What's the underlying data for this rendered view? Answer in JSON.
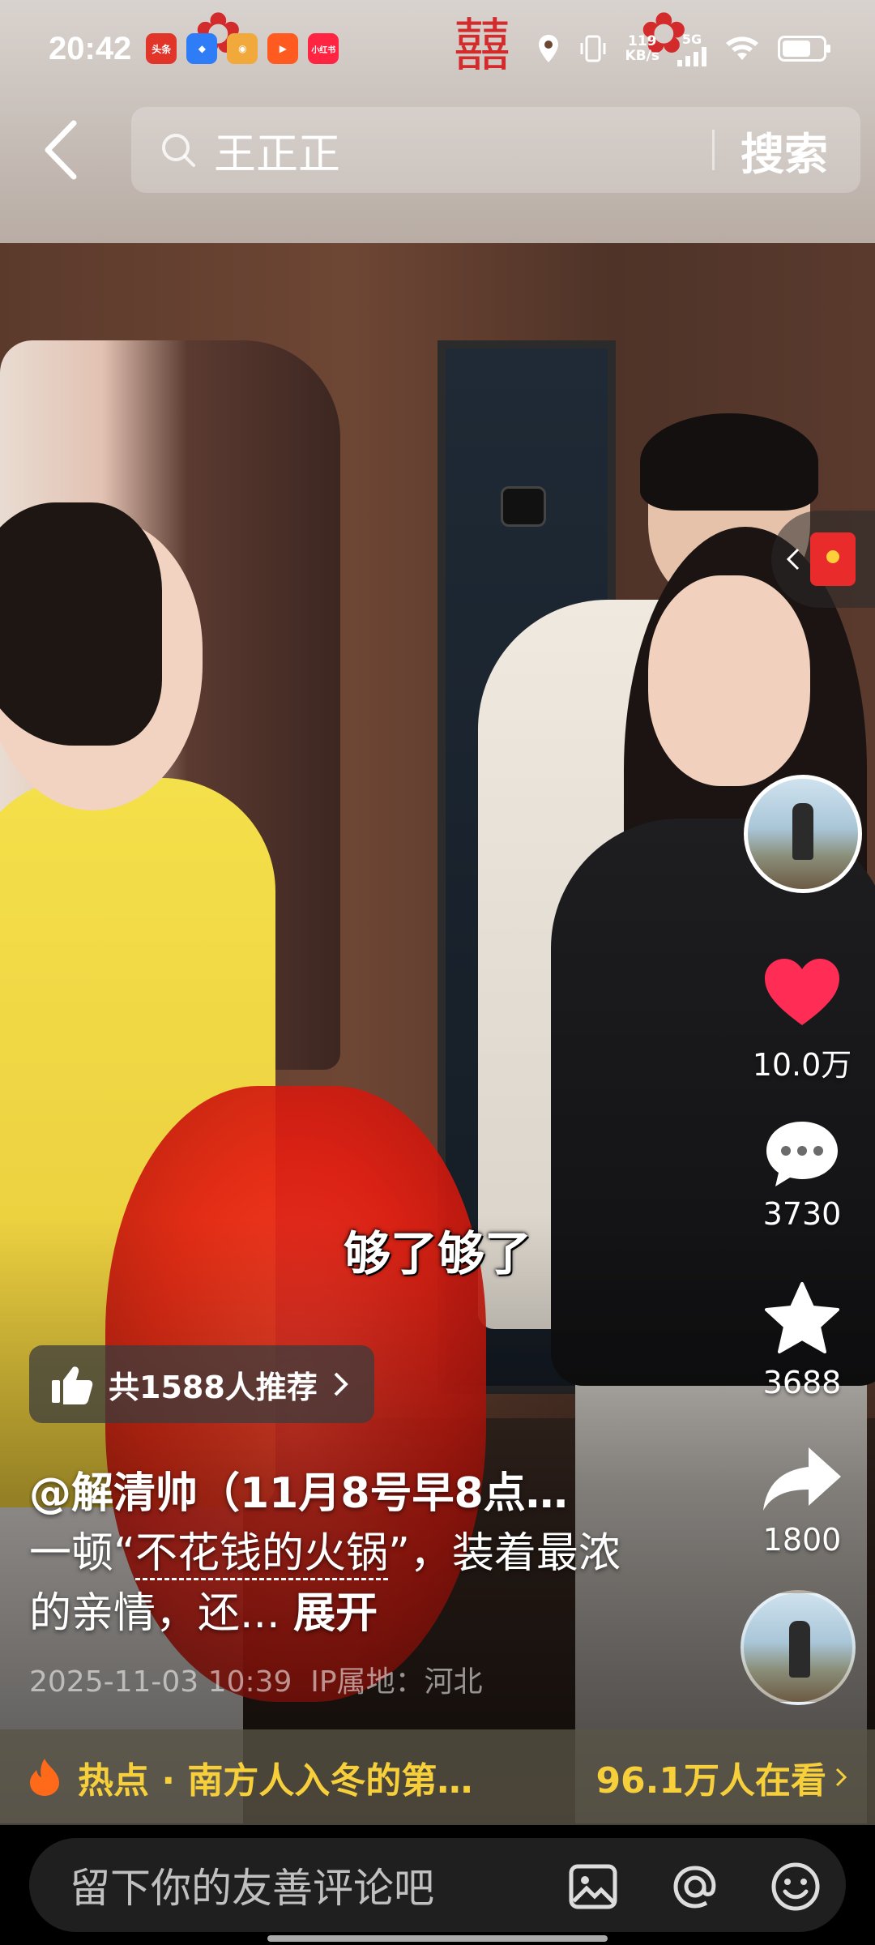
{
  "status_bar": {
    "time": "20:42",
    "app_icons": [
      {
        "name": "toutiao-icon",
        "label": "头条",
        "color": "#e2352a"
      },
      {
        "name": "browser-icon",
        "label": "",
        "color": "#2e7cf6"
      },
      {
        "name": "weibo-icon",
        "label": "",
        "color": "#f2a93b"
      },
      {
        "name": "kuaishou-icon",
        "label": "",
        "color": "#ff5a1f"
      },
      {
        "name": "xiaohongshu-icon",
        "label": "小红书",
        "color": "#ff2442"
      }
    ],
    "net_speed_value": "119",
    "net_speed_unit": "KB/s",
    "signal": "5G",
    "battery_level": 0.7
  },
  "search": {
    "query": "王正正",
    "button_label": "搜索"
  },
  "video": {
    "subtitle": "够了够了"
  },
  "actions": {
    "like_count": "10.0万",
    "comment_count": "3730",
    "favorite_count": "3688",
    "share_count": "1800"
  },
  "post": {
    "recommend_text": "共1588人推荐",
    "author": "@解清帅（11月8号早8点…",
    "desc_prefix": "一顿“",
    "desc_highlight": "不花钱的火锅",
    "desc_middle": "”，装着最浓的亲情，还...",
    "expand_label": "展开",
    "date": "2025-11-03 10:39",
    "ip_location": "IP属地：河北"
  },
  "hot_bar": {
    "title": "热点 · 南方人入冬的第…",
    "watching": "96.1万人在看"
  },
  "comment_bar": {
    "placeholder": "留下你的友善评论吧"
  },
  "colors": {
    "like_red": "#ff2c55",
    "hot_yellow": "#f6cf3b"
  }
}
